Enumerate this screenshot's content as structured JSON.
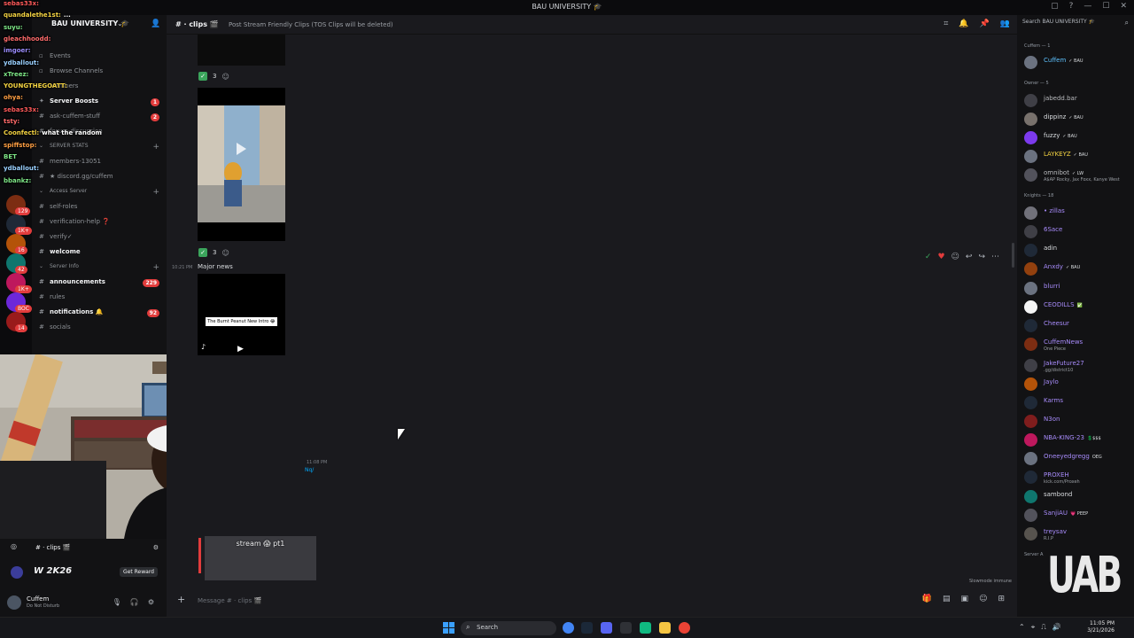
{
  "window": {
    "title": "BAU UNIVERSITY 🎓"
  },
  "server": {
    "name": "BAU UNIVERSITY 🎓"
  },
  "channels": [
    {
      "label": "Events",
      "kind": "item"
    },
    {
      "label": "Browse Channels",
      "kind": "item"
    },
    {
      "label": "Members",
      "kind": "item"
    },
    {
      "label": "Server Boosts",
      "kind": "boost",
      "badge": "1"
    },
    {
      "label": "ask-cuffem-stuff",
      "kind": "channel",
      "badge": "2"
    },
    {
      "label": "forum-discussion",
      "kind": "channel"
    },
    {
      "label": "SERVER STATS",
      "kind": "category"
    },
    {
      "label": "members-13051",
      "kind": "channel"
    },
    {
      "label": "★ discord.gg/cuffem",
      "kind": "channel"
    },
    {
      "label": "Access Server",
      "kind": "category"
    },
    {
      "label": "self-roles",
      "kind": "channel"
    },
    {
      "label": "verification-help ❓",
      "kind": "channel"
    },
    {
      "label": "verify✓",
      "kind": "channel"
    },
    {
      "label": "welcome",
      "kind": "channel-bold"
    },
    {
      "label": "Server Info",
      "kind": "category"
    },
    {
      "label": "announcements",
      "kind": "channel-bold",
      "badge": "229"
    },
    {
      "label": "rules",
      "kind": "channel"
    },
    {
      "label": "notifications 🔔",
      "kind": "channel-bold",
      "badge": "92"
    },
    {
      "label": "socials",
      "kind": "channel"
    }
  ],
  "rail_badges": [
    "129",
    "1K+",
    "16",
    "42",
    "1K+",
    "BOC",
    "14",
    "13"
  ],
  "stream_chat": [
    {
      "user": "sebas33x:",
      "msg": "",
      "color": "#ff5a5a"
    },
    {
      "user": "quandalethe1st:",
      "msg": "...",
      "color": "#f5d442"
    },
    {
      "user": "suyu:",
      "msg": "",
      "color": "#7ee787"
    },
    {
      "user": "gleachhoodd:",
      "msg": "",
      "color": "#ff6b6b"
    },
    {
      "user": "imgoer:",
      "msg": "",
      "color": "#9b8cff"
    },
    {
      "user": "ydballout:",
      "msg": "",
      "color": "#9ad0ff"
    },
    {
      "user": "xTreez:",
      "msg": "",
      "color": "#7ee787"
    },
    {
      "user": "YOUNGTHEGOATT:",
      "msg": "",
      "color": "#f5d442"
    },
    {
      "user": "ohya:",
      "msg": "",
      "color": "#ff9f43"
    },
    {
      "user": "sebas33x:",
      "msg": "",
      "color": "#ff5a5a"
    },
    {
      "user": "tsty:",
      "msg": "",
      "color": "#ff6b6b"
    },
    {
      "user": "Coonfectl:",
      "msg": "what the random",
      "color": "#f5d442"
    },
    {
      "user": "spiffstop:",
      "msg": "",
      "color": "#ff9f43"
    },
    {
      "user": "BET",
      "msg": "",
      "color": "#7ee787"
    },
    {
      "user": "ydballout:",
      "msg": "",
      "color": "#9ad0ff"
    },
    {
      "user": "bbankz:",
      "msg": "",
      "color": "#7ee787"
    }
  ],
  "active_channel": {
    "label": "clips 🎬"
  },
  "game_banner": {
    "title": "W 2K26",
    "button": "Get Reward"
  },
  "user": {
    "name": "Cuffem",
    "status": "Do Not Disturb"
  },
  "header": {
    "channel": "clips 🎬",
    "topic": "Post Stream Friendly Clips (TOS Clips will be deleted)"
  },
  "messages": {
    "reaction_count_1": "3",
    "reaction_count_2": "3",
    "time_1": "10:21 PM",
    "text_1": "Major news",
    "video_caption": "The Burnt Peanut New Intro 😂",
    "preview_caption": "stream 😱 pt1",
    "faded_time": "11:08 PM",
    "faded_link": "Nq/",
    "slowmode": "Slowmode immune"
  },
  "composer": {
    "placeholder": "Message # · clips 🎬"
  },
  "member_panel": {
    "search_placeholder": "Search BAU UNIVERSITY 🎓",
    "roles": [
      {
        "label": "Cuffem — 1"
      },
      {
        "label": "Owner — 5"
      },
      {
        "label": "Knights — 18"
      },
      {
        "label": "Server A"
      }
    ],
    "members": [
      {
        "name": "Cuffem",
        "tag": "✓ BAU",
        "sub": "",
        "color": "#5ec2ff",
        "av": "#6b7280"
      },
      {
        "name": "jabedd.bar",
        "tag": "",
        "sub": "",
        "color": "#b9bbbe",
        "av": "#3f3f46"
      },
      {
        "name": "dippinz",
        "tag": "✓ BAU",
        "sub": "",
        "color": "#dbdee1",
        "av": "#78716c"
      },
      {
        "name": "fuzzy",
        "tag": "✓ BAU",
        "sub": "",
        "color": "#dbdee1",
        "av": "#7c3aed"
      },
      {
        "name": "LAYKEYZ",
        "tag": "✓ BAU",
        "sub": "",
        "color": "#f5d442",
        "av": "#6b7280"
      },
      {
        "name": "omnibot",
        "tag": "✓ LW",
        "sub": "A$AP Rocky, Jax Foxx, Kanye West",
        "color": "#b9bbbe",
        "av": "#52525b"
      },
      {
        "name": "• zillas",
        "tag": "",
        "sub": "",
        "color": "#a78bfa",
        "av": "#71717a"
      },
      {
        "name": "6Sace",
        "tag": "",
        "sub": "",
        "color": "#a78bfa",
        "av": "#3f3f46"
      },
      {
        "name": "adin",
        "tag": "",
        "sub": "",
        "color": "#dbdee1",
        "av": "#1f2937"
      },
      {
        "name": "Anxdy",
        "tag": "✓ BAU",
        "sub": "",
        "color": "#a78bfa",
        "av": "#92400e"
      },
      {
        "name": "blurri",
        "tag": "",
        "sub": "",
        "color": "#a78bfa",
        "av": "#6b7280"
      },
      {
        "name": "CEODILLS",
        "tag": "✅",
        "sub": "",
        "color": "#a78bfa",
        "av": "#f5f5f5"
      },
      {
        "name": "Cheesur",
        "tag": "",
        "sub": "",
        "color": "#a78bfa",
        "av": "#1f2937"
      },
      {
        "name": "CuffemNews",
        "tag": "",
        "sub": "One Piece",
        "color": "#a78bfa",
        "av": "#7c2d12"
      },
      {
        "name": "JakeFuture27",
        "tag": "",
        "sub": ".gg/district10",
        "color": "#a78bfa",
        "av": "#3f3f46"
      },
      {
        "name": "Jaylo",
        "tag": "",
        "sub": "",
        "color": "#a78bfa",
        "av": "#b45309"
      },
      {
        "name": "Karms",
        "tag": "",
        "sub": "",
        "color": "#a78bfa",
        "av": "#1f2937"
      },
      {
        "name": "N3on",
        "tag": "",
        "sub": "",
        "color": "#a78bfa",
        "av": "#7f1d1d"
      },
      {
        "name": "NBA-KING-23",
        "tag": "💲$$$",
        "sub": "",
        "color": "#a78bfa",
        "av": "#be185d"
      },
      {
        "name": "Oneeyedgregg",
        "tag": "OEG",
        "sub": "",
        "color": "#a78bfa",
        "av": "#6b7280"
      },
      {
        "name": "PROXEH",
        "tag": "",
        "sub": "kick.com/Proxeh",
        "color": "#a78bfa",
        "av": "#1f2937"
      },
      {
        "name": "sambond",
        "tag": "",
        "sub": "",
        "color": "#dbdee1",
        "av": "#0f766e"
      },
      {
        "name": "SanjiAU",
        "tag": "💗 PEEP",
        "sub": "",
        "color": "#a78bfa",
        "av": "#52525b"
      },
      {
        "name": "treysav",
        "tag": "",
        "sub": "R.I.P",
        "color": "#a78bfa",
        "av": "#57534e"
      }
    ],
    "logo_text": "UAB"
  },
  "taskbar": {
    "search_label": "Search",
    "time": "11:05 PM",
    "date": "3/21/2026"
  },
  "colors": {
    "accent": "#5865f2",
    "badge_red": "#e23c3c",
    "check_green": "#3ba55c",
    "link_blue": "#00a8fc"
  }
}
